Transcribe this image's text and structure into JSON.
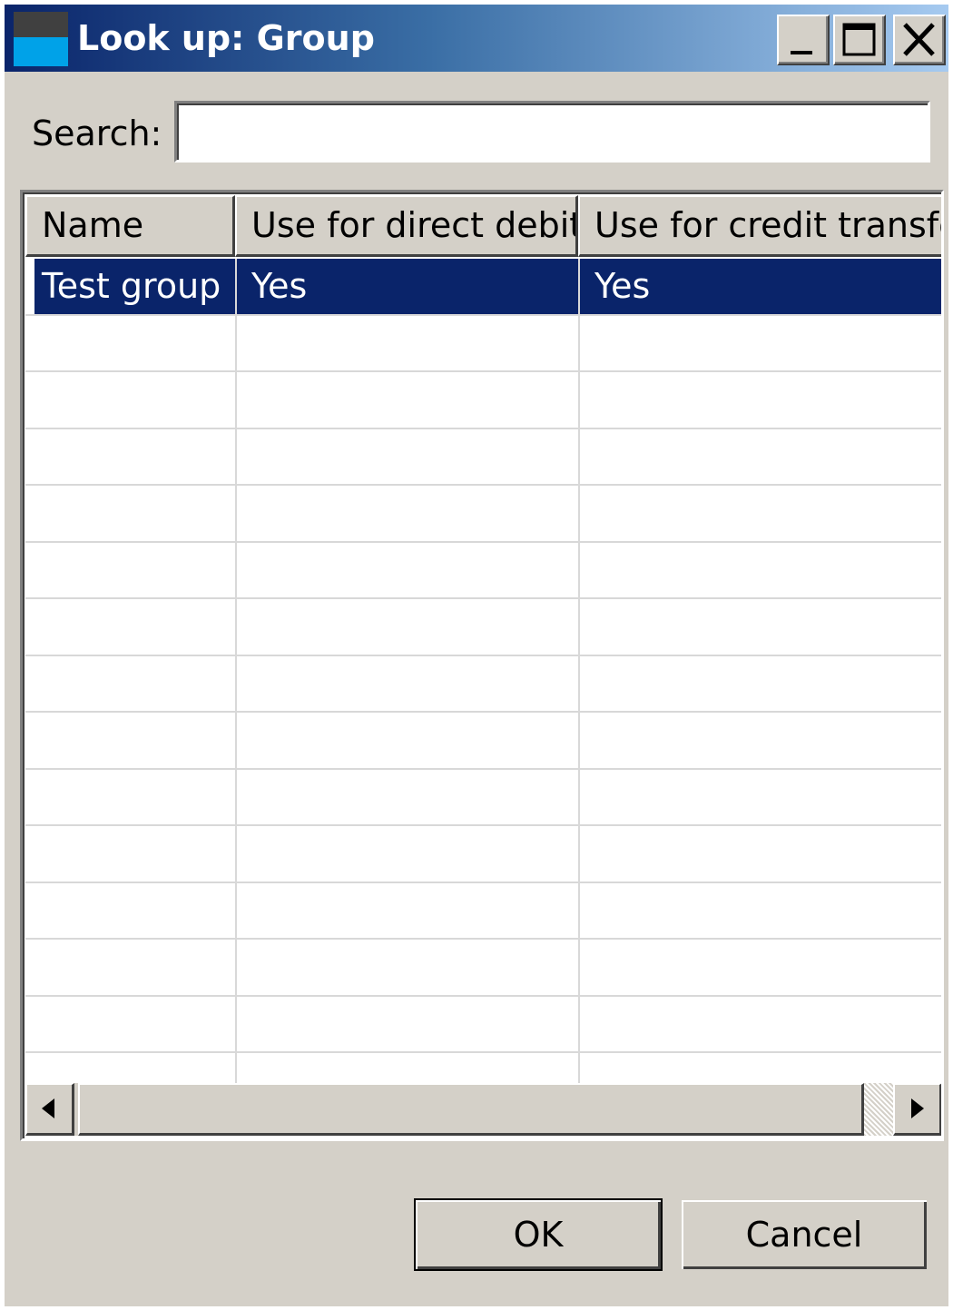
{
  "window": {
    "title": "Look up: Group",
    "title_bar_colors": [
      "#0a246a",
      "#a6caf0"
    ],
    "icon": "app-window-icon",
    "controls": {
      "minimize_icon": "minimize-icon",
      "maximize_icon": "maximize-icon",
      "close_icon": "close-icon"
    }
  },
  "search": {
    "label": "Search:",
    "value": "",
    "placeholder": ""
  },
  "table": {
    "columns": [
      "Name",
      "Use for direct debit",
      "Use for credit transfe"
    ],
    "rows": [
      {
        "name": "Test group",
        "direct_debit": "Yes",
        "credit_transfer": "Yes",
        "selected": true
      }
    ],
    "selection_color": "#0a246a"
  },
  "scrollbar": {
    "left_icon": "arrow-left-icon",
    "right_icon": "arrow-right-icon"
  },
  "buttons": {
    "ok": "OK",
    "cancel": "Cancel"
  }
}
